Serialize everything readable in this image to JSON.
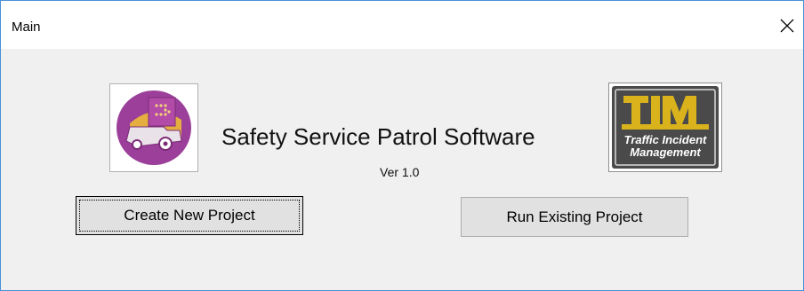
{
  "window": {
    "title": "Main",
    "close_glyph": "✕"
  },
  "app": {
    "title": "Safety Service Patrol Software",
    "version": "Ver 1.0",
    "left_logo_icon": "patrol-truck-logo-icon",
    "right_logo_icon": "tim-logo-icon"
  },
  "right_logo": {
    "line1": "Traffic Incident",
    "line2": "Management"
  },
  "buttons": {
    "create_label": "Create New Project",
    "run_label": "Run Existing Project"
  },
  "colors": {
    "window_border": "#4a90d9",
    "logo_purple": "#9b3f9a",
    "logo_yellow": "#f2c230",
    "tim_gold": "#d9b21c",
    "tim_dark": "#4a4a4a"
  }
}
